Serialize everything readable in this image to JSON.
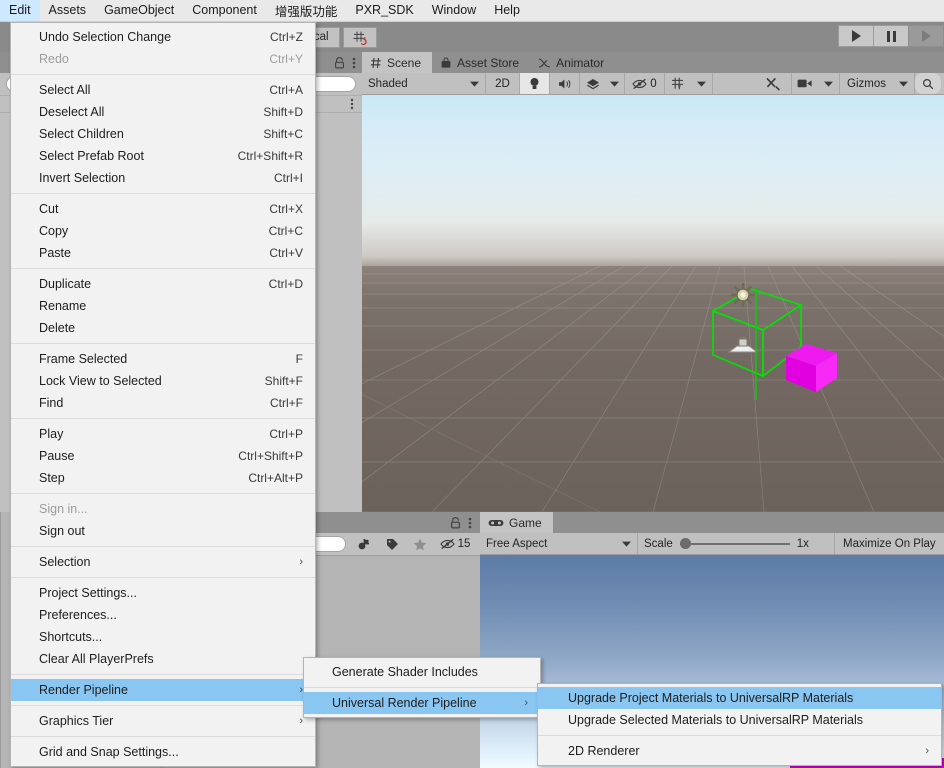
{
  "app": {
    "title": "Unity Editor",
    "accent_highlight": "#8ac6f2",
    "menu_bg": "#f2f2f2"
  },
  "menubar": {
    "items": [
      {
        "label": "Edit",
        "active": true
      },
      {
        "label": "Assets",
        "active": false
      },
      {
        "label": "GameObject",
        "active": false
      },
      {
        "label": "Component",
        "active": false
      },
      {
        "label": "增强版功能",
        "active": false
      },
      {
        "label": "PXR_SDK",
        "active": false
      },
      {
        "label": "Window",
        "active": false
      },
      {
        "label": "Help",
        "active": false
      }
    ]
  },
  "toolbar": {
    "pivot_rotation_label": "ocal",
    "grid_snap_icon": "grid-snap-icon",
    "play_icon": "play-icon",
    "pause_icon": "pause-icon",
    "step_icon": "step-icon"
  },
  "edit_menu": {
    "groups": [
      [
        {
          "label": "Undo Selection Change",
          "shortcut": "Ctrl+Z",
          "disabled": false
        },
        {
          "label": "Redo",
          "shortcut": "Ctrl+Y",
          "disabled": true
        }
      ],
      [
        {
          "label": "Select All",
          "shortcut": "Ctrl+A",
          "disabled": false
        },
        {
          "label": "Deselect All",
          "shortcut": "Shift+D",
          "disabled": false
        },
        {
          "label": "Select Children",
          "shortcut": "Shift+C",
          "disabled": false
        },
        {
          "label": "Select Prefab Root",
          "shortcut": "Ctrl+Shift+R",
          "disabled": false
        },
        {
          "label": "Invert Selection",
          "shortcut": "Ctrl+I",
          "disabled": false
        }
      ],
      [
        {
          "label": "Cut",
          "shortcut": "Ctrl+X",
          "disabled": false
        },
        {
          "label": "Copy",
          "shortcut": "Ctrl+C",
          "disabled": false
        },
        {
          "label": "Paste",
          "shortcut": "Ctrl+V",
          "disabled": false
        }
      ],
      [
        {
          "label": "Duplicate",
          "shortcut": "Ctrl+D",
          "disabled": false
        },
        {
          "label": "Rename",
          "shortcut": "",
          "disabled": false
        },
        {
          "label": "Delete",
          "shortcut": "",
          "disabled": false
        }
      ],
      [
        {
          "label": "Frame Selected",
          "shortcut": "F",
          "disabled": false
        },
        {
          "label": "Lock View to Selected",
          "shortcut": "Shift+F",
          "disabled": false
        },
        {
          "label": "Find",
          "shortcut": "Ctrl+F",
          "disabled": false
        }
      ],
      [
        {
          "label": "Play",
          "shortcut": "Ctrl+P",
          "disabled": false
        },
        {
          "label": "Pause",
          "shortcut": "Ctrl+Shift+P",
          "disabled": false
        },
        {
          "label": "Step",
          "shortcut": "Ctrl+Alt+P",
          "disabled": false
        }
      ],
      [
        {
          "label": "Sign in...",
          "shortcut": "",
          "disabled": true
        },
        {
          "label": "Sign out",
          "shortcut": "",
          "disabled": false
        }
      ],
      [
        {
          "label": "Selection",
          "shortcut": "",
          "submenu": true,
          "disabled": false
        }
      ],
      [
        {
          "label": "Project Settings...",
          "shortcut": "",
          "disabled": false
        },
        {
          "label": "Preferences...",
          "shortcut": "",
          "disabled": false
        },
        {
          "label": "Shortcuts...",
          "shortcut": "",
          "disabled": false
        },
        {
          "label": "Clear All PlayerPrefs",
          "shortcut": "",
          "disabled": false
        }
      ],
      [
        {
          "label": "Render Pipeline",
          "shortcut": "",
          "submenu": true,
          "highlighted": true,
          "disabled": false
        }
      ],
      [
        {
          "label": "Graphics Tier",
          "shortcut": "",
          "submenu": true,
          "disabled": false
        }
      ],
      [
        {
          "label": "Grid and Snap Settings...",
          "shortcut": "",
          "disabled": false
        }
      ]
    ]
  },
  "render_pipeline_menu": {
    "groups": [
      [
        {
          "label": "Generate Shader Includes",
          "submenu": false,
          "highlighted": false
        }
      ],
      [
        {
          "label": "Universal Render Pipeline",
          "submenu": true,
          "highlighted": true
        }
      ]
    ]
  },
  "urp_menu": {
    "groups": [
      [
        {
          "label": "Upgrade Project Materials to UniversalRP Materials",
          "submenu": false,
          "highlighted": true
        },
        {
          "label": "Upgrade Selected Materials to UniversalRP Materials",
          "submenu": false,
          "highlighted": false
        }
      ],
      [
        {
          "label": "2D Renderer",
          "submenu": true,
          "highlighted": false
        }
      ]
    ]
  },
  "scene_panel": {
    "tabs": [
      {
        "label": "Scene",
        "icon": "hash-icon",
        "selected": true
      },
      {
        "label": "Asset Store",
        "icon": "store-bag-icon",
        "selected": false
      },
      {
        "label": "Animator",
        "icon": "animator-icon",
        "selected": false
      }
    ],
    "toolbar": {
      "draw_mode": "Shaded",
      "two_d_label": "2D",
      "lighting_icon": "lightbulb-icon",
      "audio_icon": "speaker-icon",
      "fx_icon": "effects-icon",
      "hidden_objects_count": "0",
      "hidden_objects_icon": "eye-off-icon",
      "grid_icon": "grid-visibility-icon",
      "tools_icon": "scene-tools-icon",
      "camera_icon": "scene-camera-icon",
      "gizmos_label": "Gizmos",
      "search_icon": "search-icon"
    }
  },
  "hierarchy_panel": {
    "lock_icon": "lock-icon",
    "menu_icon": "kebab-menu-icon",
    "search_placeholder": ""
  },
  "project_panel": {
    "lock_icon": "lock-icon",
    "menu_icon": "kebab-menu-icon",
    "favorite_icon": "star-icon",
    "label_icon": "tag-icon",
    "filter_icon": "type-filter-icon",
    "hidden_count": "15",
    "hidden_icon": "eye-off-icon"
  },
  "game_panel": {
    "tabs": [
      {
        "label": "Game",
        "icon": "gamepad-icon",
        "selected": true
      }
    ],
    "toolbar": {
      "aspect": "Free Aspect",
      "scale_label": "Scale",
      "scale_value": "1x",
      "maximize_label": "Maximize On Play"
    }
  },
  "scene_content": {
    "selection_wireframe_color": "#00e400",
    "magenta_material_color": "#e800e8",
    "objects": [
      {
        "name": "selected-cube-wireframe"
      },
      {
        "name": "magenta-cube"
      },
      {
        "name": "light-gizmo"
      },
      {
        "name": "camera-gizmo"
      }
    ]
  }
}
